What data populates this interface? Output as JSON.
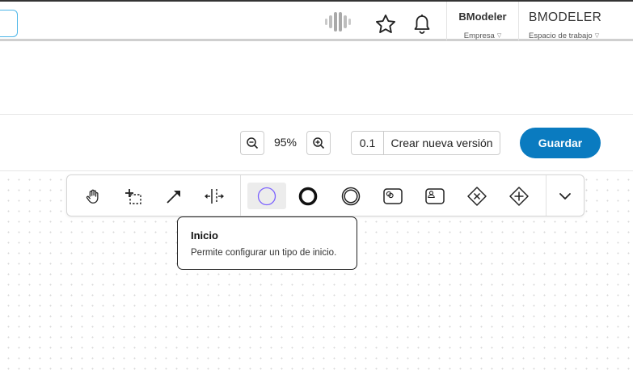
{
  "header": {
    "company": {
      "name": "BModeler",
      "label": "Empresa"
    },
    "workspace": {
      "name": "BMODELER",
      "label": "Espacio de trabajo"
    },
    "icons": [
      "brand-logo-icon",
      "star-icon",
      "bell-icon",
      "chevron-down-icon"
    ]
  },
  "toolbar": {
    "zoom_level": "95%",
    "version": "0.1",
    "new_version_label": "Crear nueva versión",
    "save_label": "Guardar",
    "save_color": "#0a7bc0"
  },
  "palette": {
    "tools": [
      {
        "id": "hand",
        "icon": "hand-icon"
      },
      {
        "id": "lasso",
        "icon": "lasso-select-icon"
      },
      {
        "id": "connect",
        "icon": "arrow-connect-icon"
      },
      {
        "id": "space",
        "icon": "space-tool-icon"
      },
      {
        "id": "start-event",
        "icon": "start-event-icon",
        "active": true,
        "color": "#7b61ff"
      },
      {
        "id": "end-event",
        "icon": "end-event-icon"
      },
      {
        "id": "intermediate-event",
        "icon": "intermediate-event-icon"
      },
      {
        "id": "service-task",
        "icon": "service-task-icon"
      },
      {
        "id": "user-task",
        "icon": "user-task-icon"
      },
      {
        "id": "exclusive-gateway",
        "icon": "exclusive-gateway-icon"
      },
      {
        "id": "parallel-gateway",
        "icon": "parallel-gateway-icon"
      },
      {
        "id": "more",
        "icon": "chevron-down-icon"
      }
    ]
  },
  "tooltip": {
    "title": "Inicio",
    "text": "Permite configurar un tipo de inicio."
  }
}
